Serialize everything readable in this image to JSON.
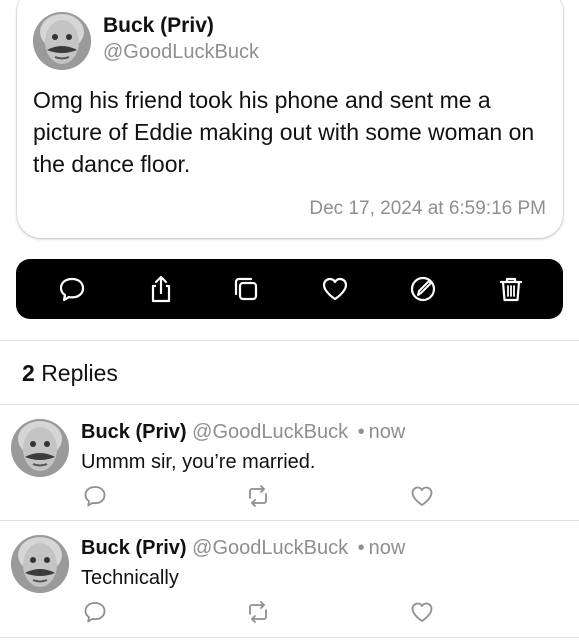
{
  "post": {
    "author_name": "Buck (Priv)",
    "author_handle": "@GoodLuckBuck",
    "text": "Omg his friend took his phone and sent me a picture of Eddie making out with some woman on the dance floor.",
    "timestamp": "Dec 17, 2024 at 6:59:16 PM"
  },
  "actions": [
    {
      "icon": "speech-bubble-icon"
    },
    {
      "icon": "share-icon"
    },
    {
      "icon": "copy-icon"
    },
    {
      "icon": "heart-icon"
    },
    {
      "icon": "edit-icon"
    },
    {
      "icon": "trash-icon"
    }
  ],
  "replies_header": {
    "count": "2",
    "label": "Replies"
  },
  "replies": [
    {
      "author_name": "Buck (Priv)",
      "author_handle": "@GoodLuckBuck",
      "separator": "•",
      "time": "now",
      "text": "Ummm sir, you’re married."
    },
    {
      "author_name": "Buck (Priv)",
      "author_handle": "@GoodLuckBuck",
      "separator": "•",
      "time": "now",
      "text": "Technically"
    }
  ],
  "colors": {
    "text": "#111111",
    "secondary": "#8e8e93",
    "action_bar": "#000000",
    "divider": "#e2e2e4"
  }
}
